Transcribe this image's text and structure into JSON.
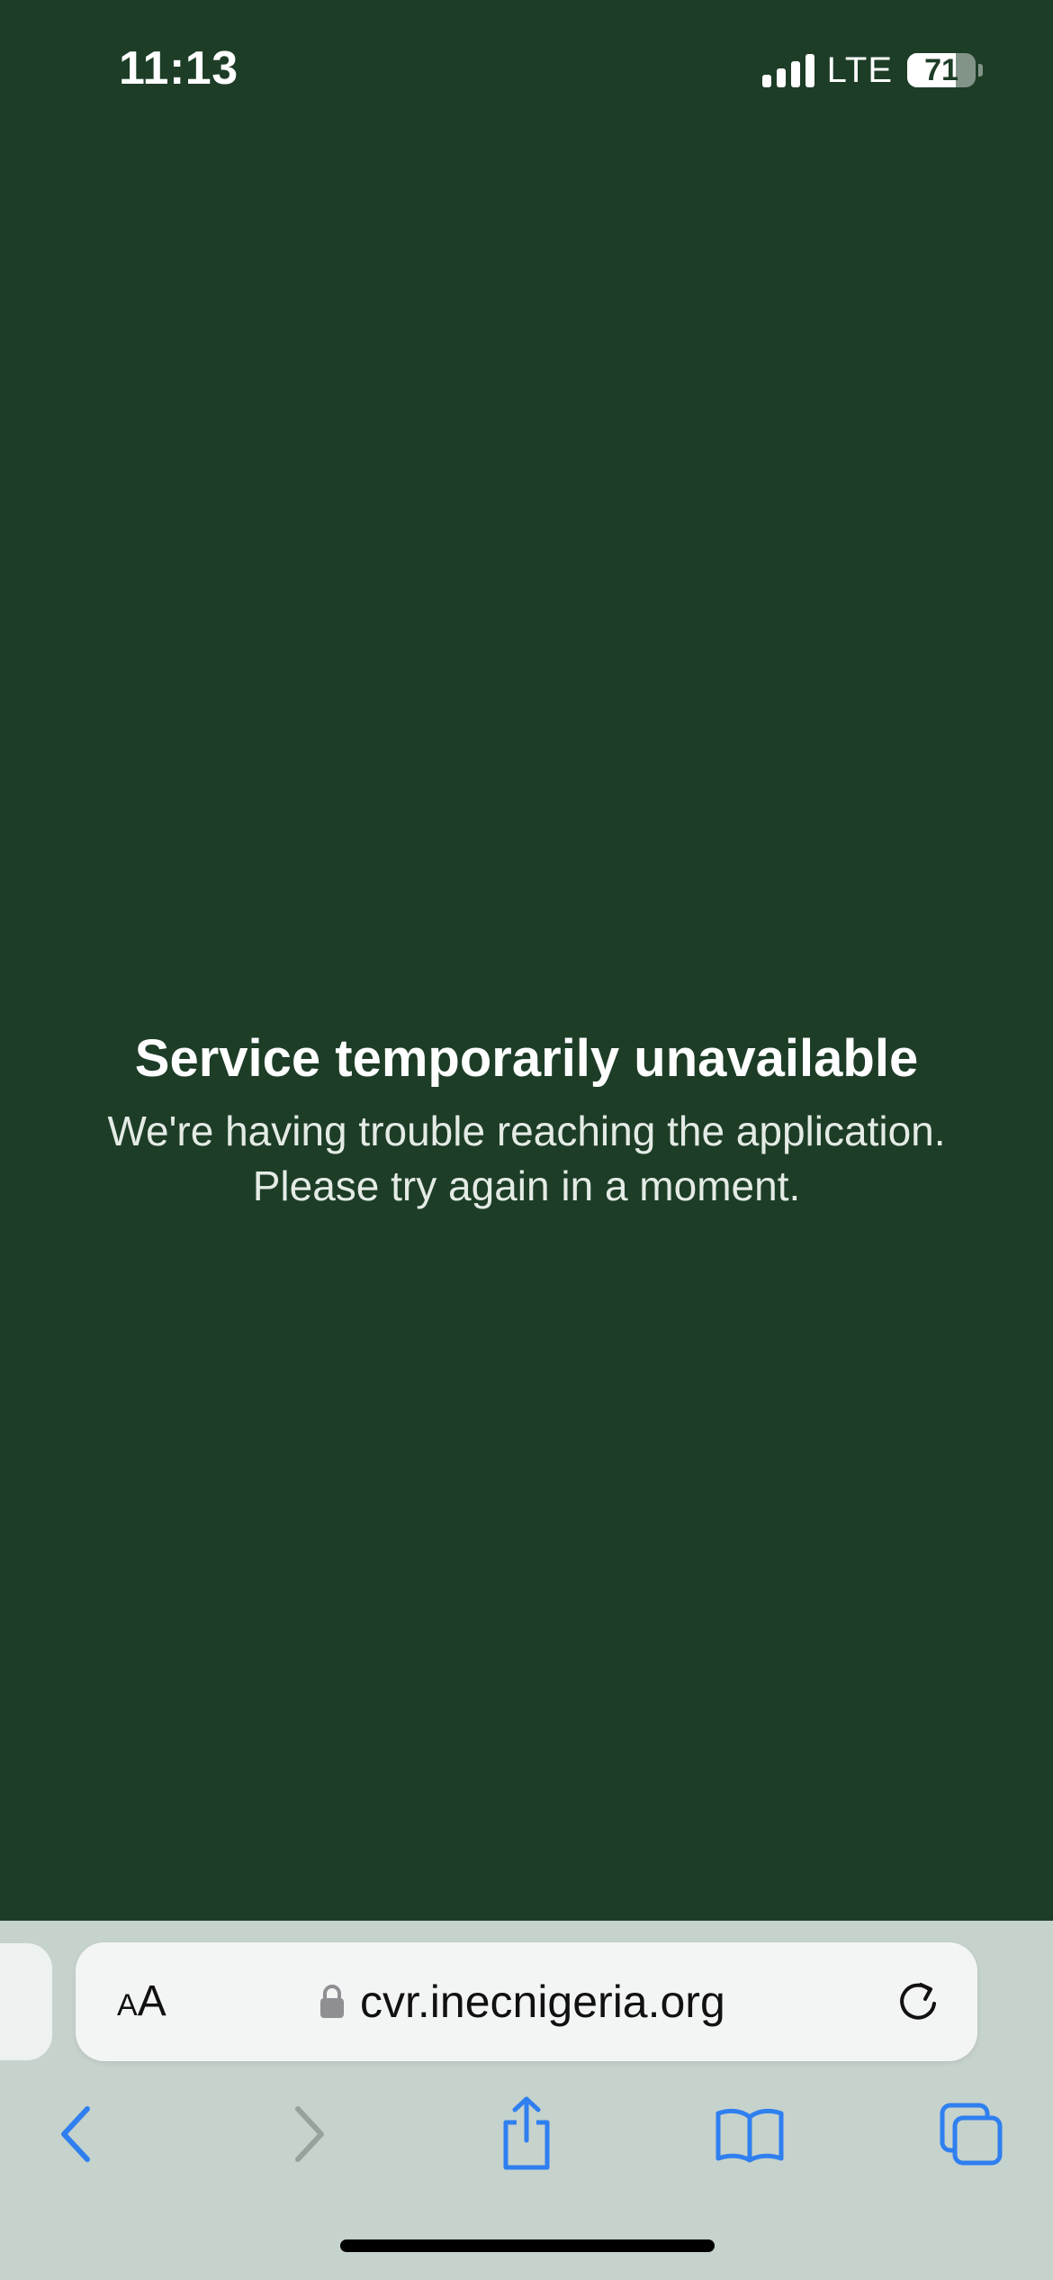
{
  "status_bar": {
    "time": "11:13",
    "network": "LTE",
    "battery_percent": "71",
    "battery_level": 0.71,
    "signal_bars": 4
  },
  "page": {
    "title": "Service temporarily unavailable",
    "message": "We're having trouble reaching the application. Please try again in a moment."
  },
  "browser": {
    "reader_label_small": "A",
    "reader_label_large": "A",
    "url": "cvr.inecnigeria.org",
    "icons": {
      "lock": "lock-icon",
      "reload": "reload-icon",
      "back": "chevron-left-icon",
      "forward": "chevron-right-icon",
      "share": "share-icon",
      "bookmarks": "book-icon",
      "tabs": "tabs-icon"
    }
  },
  "colors": {
    "page_background": "#1d3d27",
    "toolbar_background": "#c6d2cc",
    "accent": "#2f7ff0",
    "disabled": "#98a29d"
  }
}
